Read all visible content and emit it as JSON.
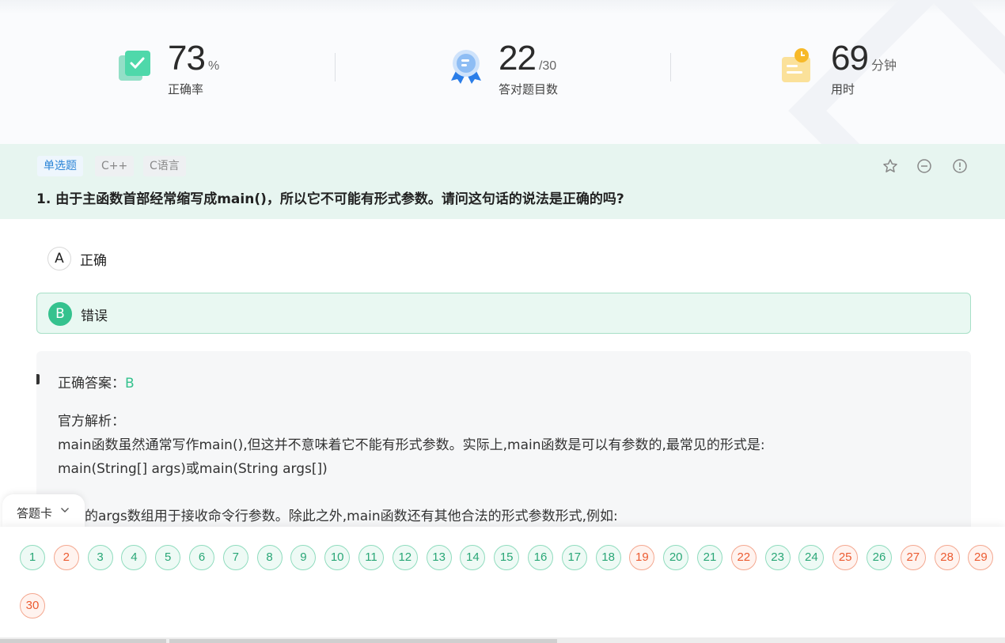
{
  "stats": {
    "accuracy": {
      "value": "73",
      "unit": "%",
      "label": "正确率",
      "icon": "check-card-icon"
    },
    "correct": {
      "value": "22",
      "unit": "/30",
      "label": "答对题目数",
      "icon": "medal-icon"
    },
    "time": {
      "value": "69",
      "unit": "分钟",
      "label": "用时",
      "icon": "clock-note-icon"
    }
  },
  "question": {
    "type_tag": "单选题",
    "tags": [
      "C++",
      "C语言"
    ],
    "title": "1. 由于主函数首部经常缩写成main()，所以它不可能有形式参数。请问这句话的说法是正确的吗?",
    "tools": [
      "star-icon",
      "minus-circle-icon",
      "info-circle-icon"
    ]
  },
  "options": [
    {
      "letter": "A",
      "text": "正确",
      "selected": false
    },
    {
      "letter": "B",
      "text": "错误",
      "selected": true
    }
  ],
  "analysis": {
    "answer_label": "正确答案：",
    "answer_value": "B",
    "official_label": "官方解析：",
    "line1": "main函数虽然通常写作main(),但这并不意味着它不能有形式参数。实际上,main函数是可以有参数的,最常见的形式是:",
    "line2": "main(String[] args)或main(String args[])",
    "line3": "其中的args数组用于接收命令行参数。除此之外,main函数还有其他合法的形式参数形式,例如:"
  },
  "answer_card": {
    "title": "答题卡",
    "wrong": [
      2,
      19,
      22,
      25,
      27,
      28,
      29,
      30
    ],
    "total": 30
  },
  "colors": {
    "accent_green": "#35c28e",
    "wrong_orange": "#ec5b31",
    "tag_blue": "#2a84d6",
    "header_bg": "#e7f5f0"
  }
}
